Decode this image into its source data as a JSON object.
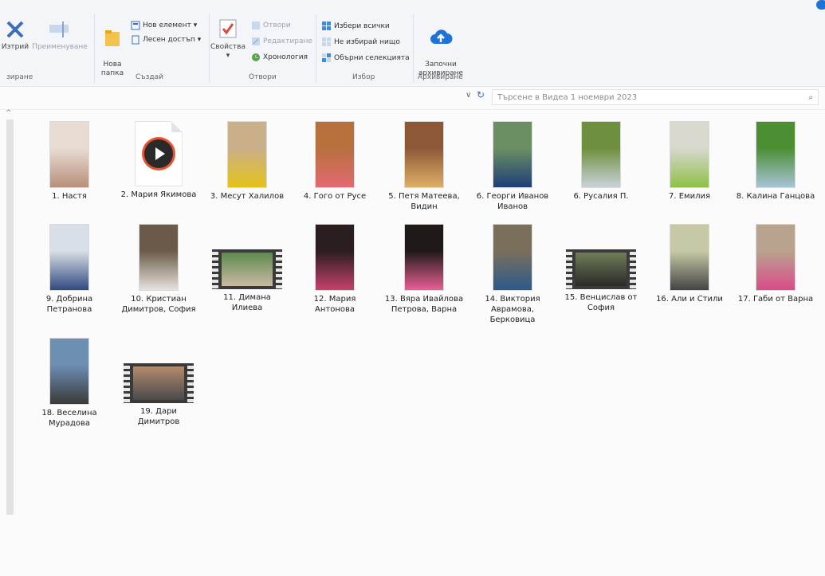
{
  "ribbon": {
    "delete_label": "Изтрий",
    "rename_label": "Преименуване",
    "new_folder_label": "Нова\nпапка",
    "new_item_label": "Нов елемент",
    "easy_access_label": "Лесен достъп",
    "properties_label": "Свойства",
    "open_label": "Отвори",
    "edit_label": "Редактиране",
    "history_label": "Хронология",
    "select_all_label": "Избери всички",
    "select_none_label": "Не избирай нищо",
    "invert_label": "Обърни селекцията",
    "archive_label": "Започни\nархивиране",
    "groups": {
      "organize": "зиране",
      "create": "Създай",
      "open": "Отвори",
      "select": "Избор",
      "archive": "Архивиране"
    }
  },
  "search": {
    "placeholder": "Търсене в Видеа 1 ноември 2023"
  },
  "files": [
    {
      "name": "1. Настя",
      "type": "portrait",
      "colors": [
        "#e9dcd3",
        "#b88f7a"
      ]
    },
    {
      "name": "2. Мария Якимова",
      "type": "doc"
    },
    {
      "name": "3. Месут Халилов",
      "type": "portrait",
      "colors": [
        "#c9b089",
        "#e6c21a"
      ]
    },
    {
      "name": "4. Гого от Русе",
      "type": "portrait",
      "colors": [
        "#b8703d",
        "#e36a73"
      ]
    },
    {
      "name": "5. Петя Матеева, Видин",
      "type": "portrait",
      "colors": [
        "#8c5838",
        "#ddb065"
      ]
    },
    {
      "name": "6. Георги Иванов Иванов",
      "type": "portrait",
      "colors": [
        "#6b8f62",
        "#1f3f77"
      ]
    },
    {
      "name": "6. Русалия П.",
      "type": "portrait",
      "colors": [
        "#6e8f3d",
        "#c9d2d9"
      ]
    },
    {
      "name": "7. Емилия",
      "type": "portrait",
      "colors": [
        "#d8d8cf",
        "#8ec047"
      ]
    },
    {
      "name": "8. Калина Ганцова",
      "type": "portrait",
      "colors": [
        "#4c8f33",
        "#a8c3d8"
      ]
    },
    {
      "name": "9. Добрина Петранова",
      "type": "portrait",
      "colors": [
        "#d9dfe6",
        "#31497f"
      ]
    },
    {
      "name": "10. Кристиан Димитров, София",
      "type": "portrait",
      "colors": [
        "#6a5a4a",
        "#e6e3de"
      ]
    },
    {
      "name": "11. Димана Илиева",
      "type": "film",
      "colors": [
        "#5d8a4d",
        "#c9b9a4"
      ]
    },
    {
      "name": "12. Мария Антонова",
      "type": "portrait",
      "colors": [
        "#2a1e1e",
        "#c5426b"
      ]
    },
    {
      "name": "13. Вяра Ивайлова Петрова, Варна",
      "type": "portrait",
      "colors": [
        "#1f1a18",
        "#e85f96"
      ]
    },
    {
      "name": "14. Виктория Аврамова, Берковица",
      "type": "portrait",
      "colors": [
        "#7a6f5b",
        "#2d5a8a"
      ]
    },
    {
      "name": "15. Венцислав от София",
      "type": "film",
      "colors": [
        "#6f7d56",
        "#2a2a2a"
      ]
    },
    {
      "name": "16. Али и Стили",
      "type": "portrait",
      "colors": [
        "#c7c9a6",
        "#444444"
      ]
    },
    {
      "name": "17. Габи от Варна",
      "type": "portrait",
      "colors": [
        "#b9a38f",
        "#d94c8a"
      ]
    },
    {
      "name": "18. Веселина Мурадова",
      "type": "portrait",
      "colors": [
        "#6d8fb3",
        "#3a3a3a"
      ]
    },
    {
      "name": "19. Дари Димитров",
      "type": "film",
      "colors": [
        "#b58b6f",
        "#4a4a4a"
      ]
    }
  ]
}
